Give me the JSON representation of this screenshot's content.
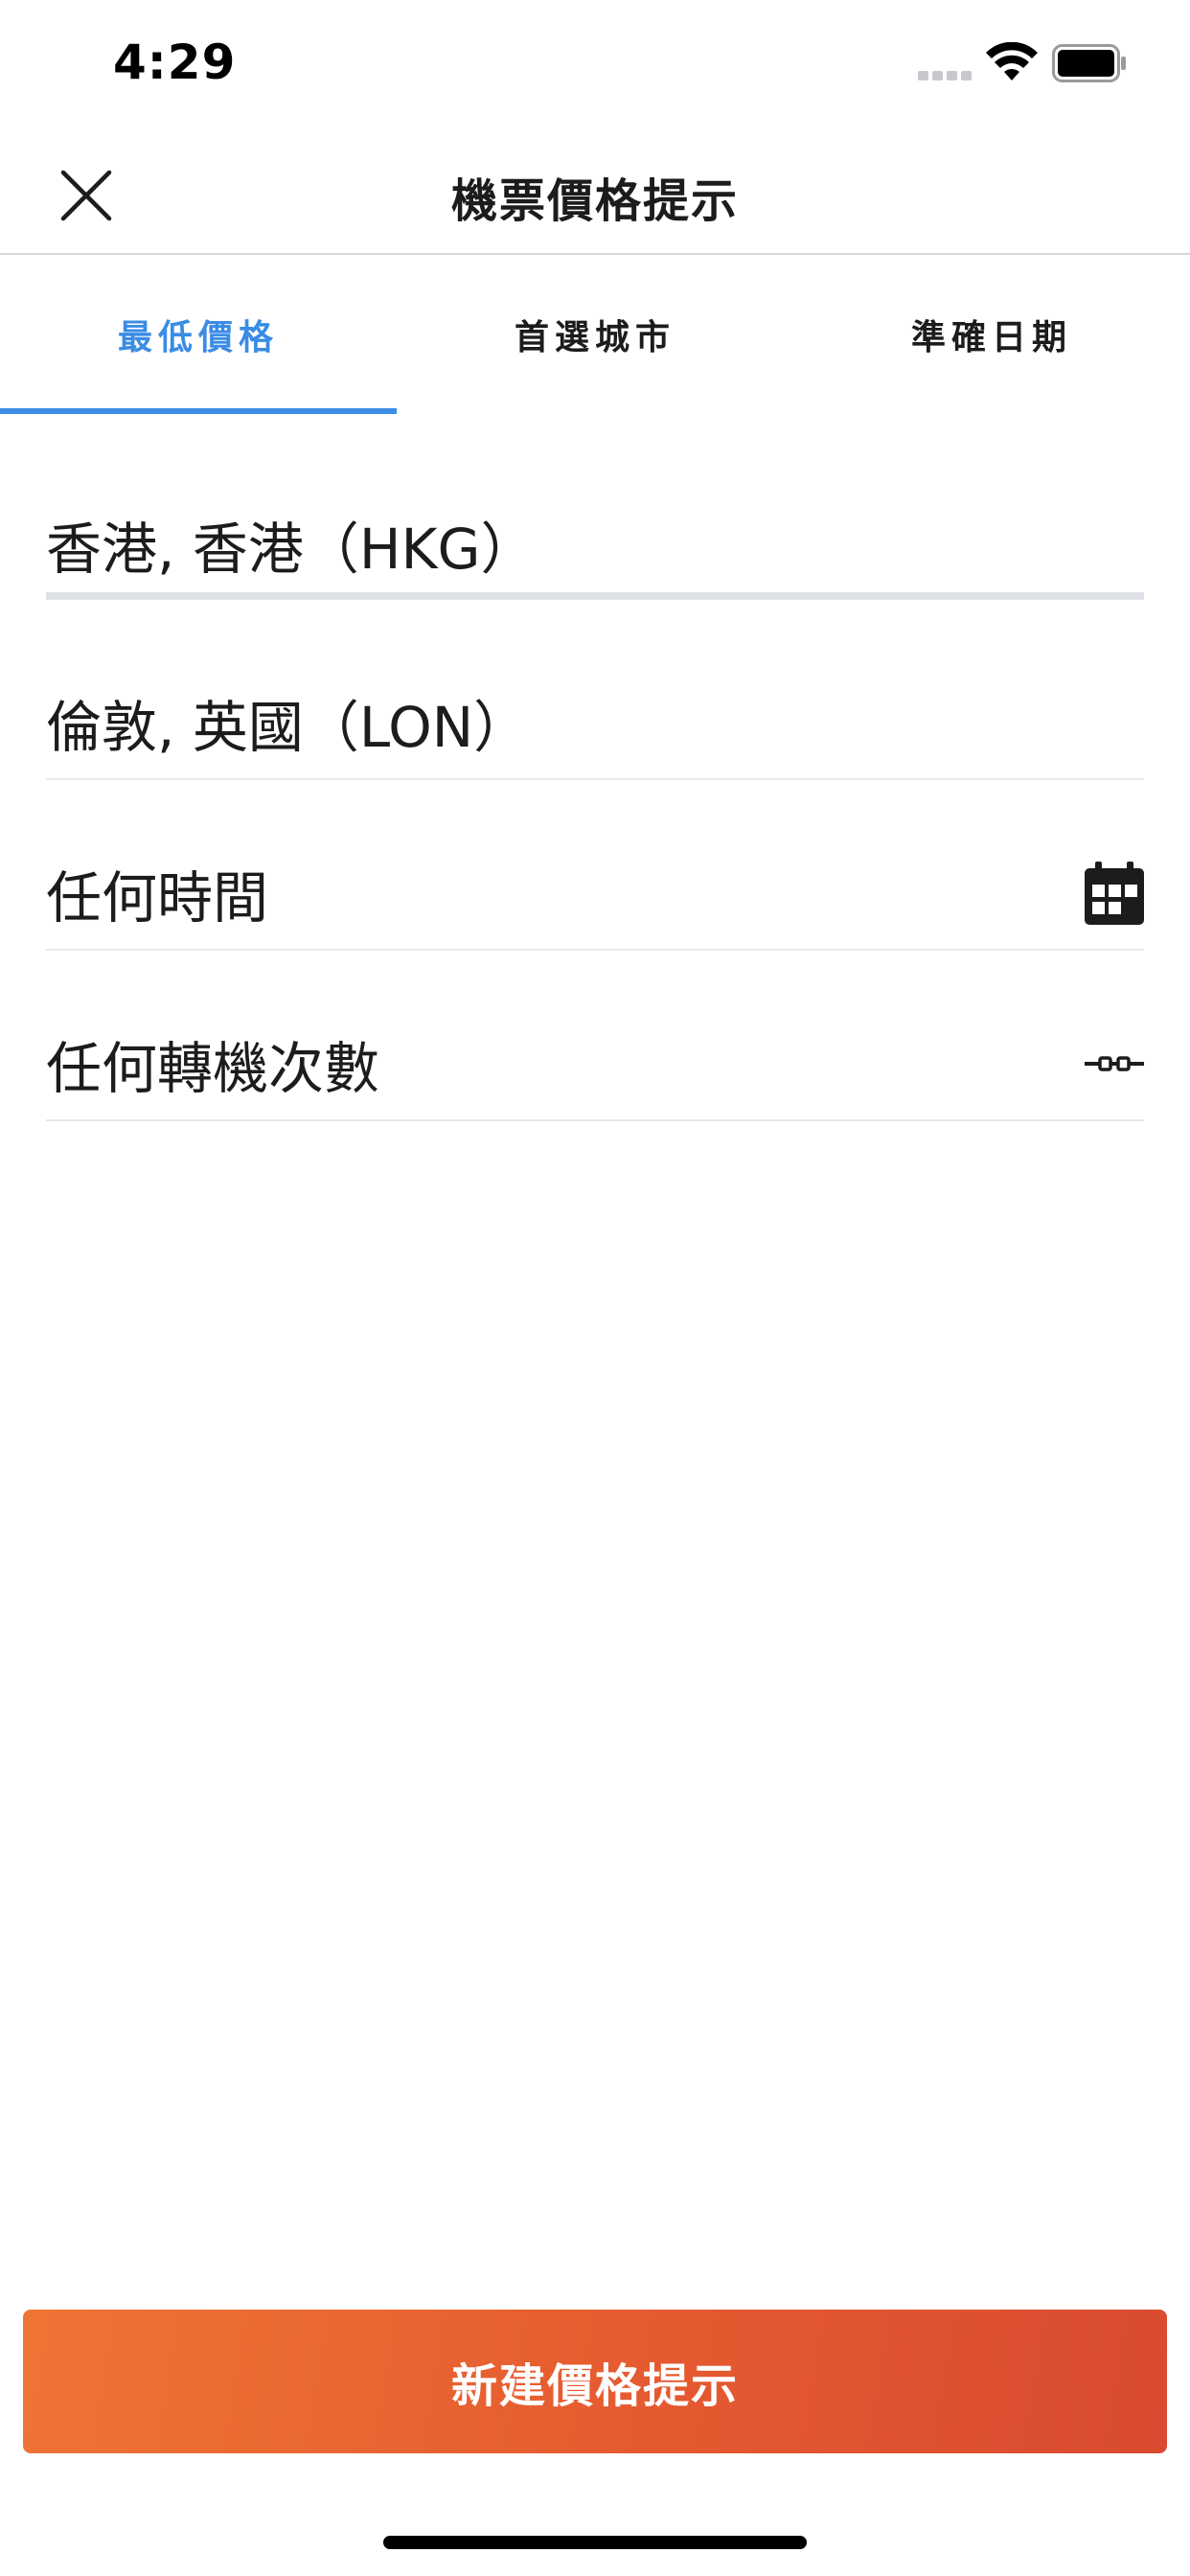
{
  "status_bar": {
    "time": "4:29"
  },
  "header": {
    "title": "機票價格提示",
    "close_icon": "close-icon"
  },
  "tabs": [
    {
      "label": "最低價格",
      "active": true
    },
    {
      "label": "首選城市",
      "active": false
    },
    {
      "label": "準確日期",
      "active": false
    }
  ],
  "form": {
    "origin": "香港, 香港（HKG）",
    "destination": "倫敦, 英國（LON）",
    "date": "任何時間",
    "date_icon": "calendar-icon",
    "stops": "任何轉機次數",
    "stops_icon": "stops-icon"
  },
  "actions": {
    "create_label": "新建價格提示"
  },
  "colors": {
    "accent": "#3a8ce4",
    "button_start": "#ef7434",
    "button_end": "#d94a30"
  }
}
